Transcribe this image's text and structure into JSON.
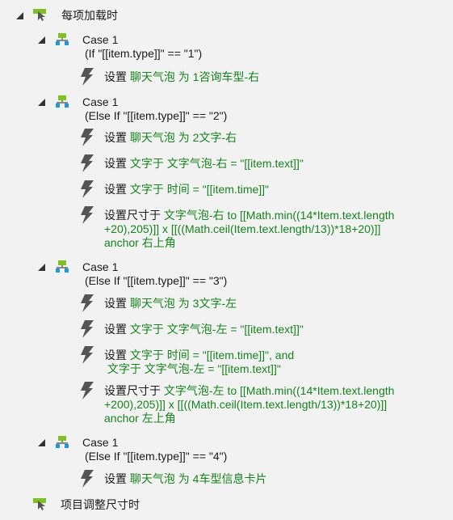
{
  "events": [
    {
      "label": "每项加载时",
      "cases": [
        {
          "title": "Case 1",
          "condition": "(If \"[[item.type]]\" == \"1\")",
          "actions": [
            {
              "verb": "设置",
              "lines": [
                "聊天气泡 为 1咨询车型-右"
              ]
            }
          ]
        },
        {
          "title": "Case 1",
          "condition": "(Else If \"[[item.type]]\" == \"2\")",
          "actions": [
            {
              "verb": "设置",
              "lines": [
                "聊天气泡 为 2文字-右"
              ]
            },
            {
              "verb": "设置",
              "lines": [
                "文字于 文字气泡-右 = \"[[item.text]]\""
              ]
            },
            {
              "verb": "设置",
              "lines": [
                "文字于 时间 = \"[[item.time]]\""
              ]
            },
            {
              "verb": "设置尺寸于",
              "lines": [
                "文字气泡-右 to [[Math.min((14*Item.text.length",
                "+20),205)]] x [[((Math.ceil(Item.text.length/13))*18+20)]]",
                "anchor 右上角"
              ]
            }
          ]
        },
        {
          "title": "Case 1",
          "condition": "(Else If \"[[item.type]]\" == \"3\")",
          "actions": [
            {
              "verb": "设置",
              "lines": [
                "聊天气泡 为 3文字-左"
              ]
            },
            {
              "verb": "设置",
              "lines": [
                "文字于 文字气泡-左 = \"[[item.text]]\""
              ]
            },
            {
              "verb": "设置",
              "lines": [
                "文字于 时间 = \"[[item.time]]\", and",
                " 文字于 文字气泡-左 = \"[[item.text]]\""
              ]
            },
            {
              "verb": "设置尺寸于",
              "lines": [
                "文字气泡-左 to [[Math.min((14*Item.text.length",
                "+200),205)]] x [[((Math.ceil(Item.text.length/13))*18+20)]]",
                "anchor 左上角"
              ]
            }
          ]
        },
        {
          "title": "Case 1",
          "condition": "(Else If \"[[item.type]]\" == \"4\")",
          "actions": [
            {
              "verb": "设置",
              "lines": [
                "聊天气泡 为 4车型信息卡片"
              ]
            }
          ]
        }
      ]
    },
    {
      "label": "项目调整尺寸时",
      "cases": []
    }
  ],
  "colors": {
    "action_text": "#14851a",
    "event_bar": "#7dc21e",
    "case_top": "#7dc21e",
    "case_bottom": "#1a9ad6"
  }
}
